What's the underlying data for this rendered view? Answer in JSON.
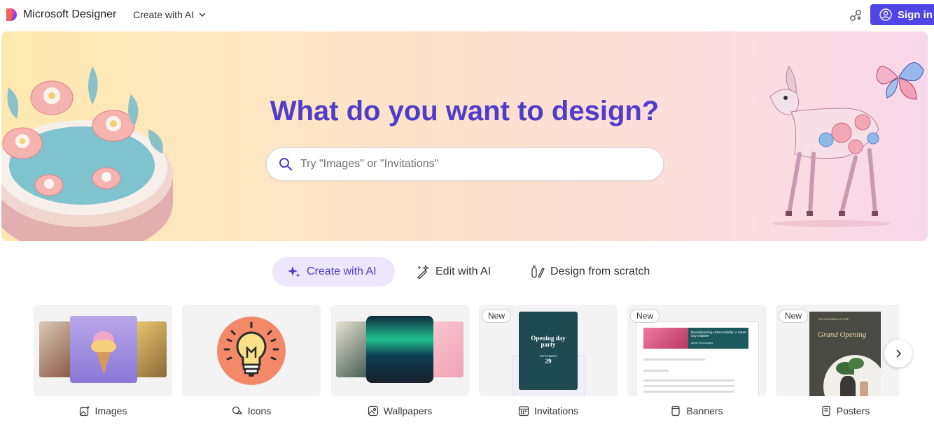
{
  "header": {
    "brand": "Microsoft Designer",
    "nav_create": "Create with AI",
    "signin": "Sign in"
  },
  "hero": {
    "title": "What do you want to design?",
    "search_placeholder": "Try \"Images\" or \"Invitations\""
  },
  "modes": [
    {
      "label": "Create with AI",
      "icon": "sparkle-icon",
      "selected": true
    },
    {
      "label": "Edit with AI",
      "icon": "magic-wand-icon",
      "selected": false
    },
    {
      "label": "Design from scratch",
      "icon": "pen-brush-icon",
      "selected": false
    }
  ],
  "categories": [
    {
      "label": "Images",
      "icon": "image-sparkle-icon",
      "badge": ""
    },
    {
      "label": "Icons",
      "icon": "icons-icon",
      "badge": ""
    },
    {
      "label": "Wallpapers",
      "icon": "wallpaper-icon",
      "badge": ""
    },
    {
      "label": "Invitations",
      "icon": "calendar-icon",
      "badge": "New"
    },
    {
      "label": "Banners",
      "icon": "banner-icon",
      "badge": "New"
    },
    {
      "label": "Posters",
      "icon": "poster-icon",
      "badge": "New"
    }
  ],
  "invitation_card": {
    "title": "Opening day party",
    "day": "29",
    "month": "SEPTEMBER"
  },
  "banner_card": {
    "heading": "Revolutionizing Urban Mobility: A Smart City Initiative",
    "sub": "Alpine Technologies"
  },
  "poster_card": {
    "small": "THE PASHMINA STORE",
    "title": "Grand Opening"
  },
  "colors": {
    "accent": "#4f46e5",
    "title": "#4f3cc9",
    "tab_bg": "#ece7fc"
  }
}
